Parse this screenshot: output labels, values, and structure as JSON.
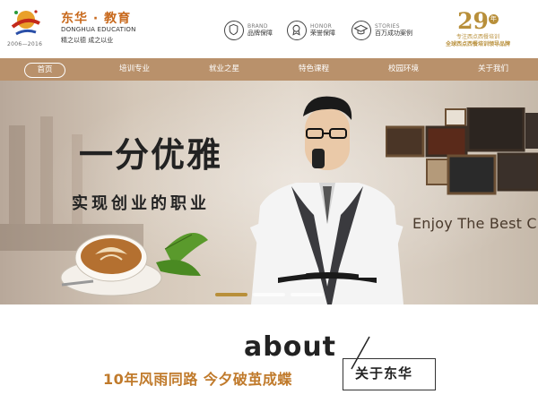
{
  "header": {
    "logo": {
      "name": "东华 · 教育",
      "english": "DONGHUA EDUCATION",
      "slogan": "精之以德 成之以业",
      "years": "2006—2016"
    },
    "badges": [
      {
        "en": "BRAND",
        "cn": "品牌保障",
        "icon": "shield-icon"
      },
      {
        "en": "HONOR",
        "cn": "荣誉保障",
        "icon": "medal-icon"
      },
      {
        "en": "STORIES",
        "cn": "百万成功案例",
        "icon": "graduation-cap-icon"
      }
    ],
    "years_badge": {
      "number": "29",
      "suffix": "年",
      "line1": "专注西点西餐培训",
      "line2": "全球西点西餐培训领导品牌"
    }
  },
  "nav": {
    "items": [
      {
        "label": "首页",
        "active": true
      },
      {
        "label": "培训专业"
      },
      {
        "label": "就业之星"
      },
      {
        "label": "特色课程"
      },
      {
        "label": "校园环境"
      },
      {
        "label": "关于我们"
      }
    ]
  },
  "banner": {
    "headline": "一分优雅",
    "subline": "实现创业的职业",
    "tagline": "Enjoy The Best C",
    "slides": 3,
    "active_slide": 0
  },
  "about": {
    "word": "about",
    "tagline": "10年风雨同路  今夕破茧成蝶",
    "title_cn": "关于东华"
  },
  "colors": {
    "nav_bg": "#b9916b",
    "accent_gold": "#b88f3a",
    "accent_orange": "#c07a2b",
    "logo_orange": "#c8691c"
  }
}
